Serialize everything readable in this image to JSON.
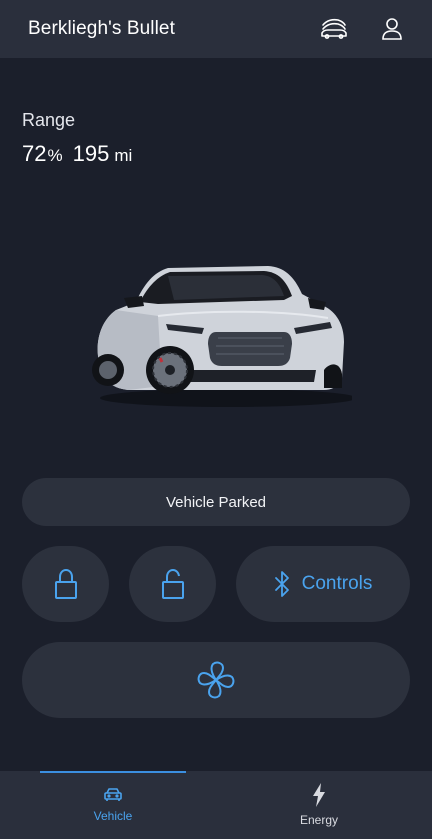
{
  "header": {
    "title": "Berkliegh's Bullet",
    "icons": [
      "car-wash-icon",
      "profile-icon"
    ]
  },
  "range": {
    "label": "Range",
    "percent": "72",
    "percent_sign": "%",
    "miles": "195",
    "miles_unit": "mi"
  },
  "vehicle_image": "car-image",
  "status": {
    "text": "Vehicle Parked"
  },
  "actions": {
    "lock_icon": "lock-icon",
    "unlock_icon": "unlock-icon",
    "controls_label": "Controls",
    "controls_icon": "bluetooth-icon",
    "climate_icon": "fan-icon"
  },
  "nav": {
    "items": [
      {
        "label": "Vehicle",
        "icon": "car-icon",
        "active": true
      },
      {
        "label": "Energy",
        "icon": "lightning-icon",
        "active": false
      }
    ]
  },
  "colors": {
    "background": "#1b1f2b",
    "surface": "#2c313d",
    "header": "#2a2f3c",
    "accent": "#4aa3ee",
    "text": "#ffffff"
  }
}
